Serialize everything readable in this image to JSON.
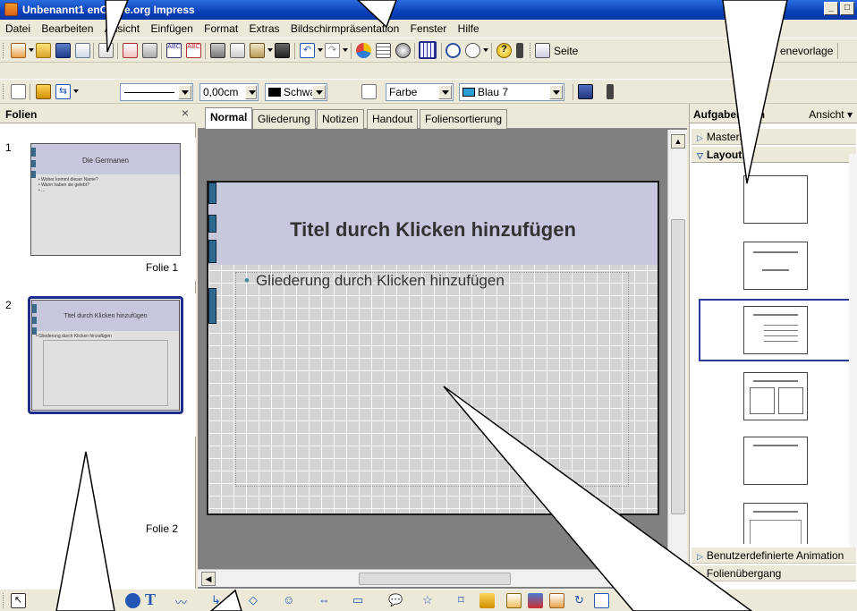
{
  "window": {
    "title": "Unbenannt1 - OpenOffice.org Impress",
    "title_visible": "Unbenannt1          enOffice.org Impress"
  },
  "menu": [
    "Datei",
    "Bearbeiten",
    "Ansicht",
    "Einfügen",
    "Format",
    "Extras",
    "Bildschirmpräsentation",
    "Fenster",
    "Hilfe"
  ],
  "toolbar1": {
    "slide_layout_label": "Seite",
    "master_label": "enevorlage"
  },
  "toolbar2": {
    "line_width": "0,00cm",
    "line_color": "Schwarz",
    "area_style": "Farbe",
    "area_color": "Blau 7"
  },
  "slides_panel": {
    "title": "Folien",
    "close_symbol": "×",
    "slides": [
      {
        "number": "1",
        "title": "Die Germanen",
        "body": "• Woher kommt dieser Name?\n• Wann haben sie gelebt?\n• ...",
        "caption": "Folie 1"
      },
      {
        "number": "2",
        "title": "Titel durch Klicken hinzufügen",
        "body": "• Gliederung durch Klicken hinzufügen",
        "caption": "Folie 2"
      }
    ]
  },
  "view_tabs": [
    "Normal",
    "Gliederung",
    "Notizen",
    "Handout",
    "Foliensortierung"
  ],
  "slide": {
    "title_placeholder": "Titel durch Klicken hinzufügen",
    "body_placeholder": "Gliederung durch Klicken hinzufügen",
    "bullet": "•"
  },
  "task_pane": {
    "title": "Aufgabenbereich",
    "title_visible": "Aufgabenb      ch",
    "view_label": "Ansicht",
    "sections": {
      "master": "Masterseiten",
      "master_visible": "Masterseit",
      "layouts": "Layouts",
      "animation": "Benutzerdefinierte Animation",
      "transition": "Folienübergang"
    }
  },
  "icons": [
    "new-icon",
    "open-icon",
    "save-icon",
    "mail-icon",
    "edit-icon",
    "pdf-icon",
    "print-icon",
    "spellcheck-icon",
    "autospell-icon",
    "cut-icon",
    "copy-icon",
    "paste-icon",
    "format-paintbrush-icon",
    "undo-icon",
    "redo-icon",
    "chart-icon",
    "table-icon",
    "navigator-icon",
    "grid-icon",
    "zoom-icon",
    "help-icon",
    "select-icon",
    "text-icon",
    "ellipse-icon"
  ],
  "colors": {
    "titlebar": "#0a3fb8",
    "selection": "#2b3a9a",
    "slide_title_band": "#c7c7de",
    "accent_bar": "#2d6a8f"
  }
}
